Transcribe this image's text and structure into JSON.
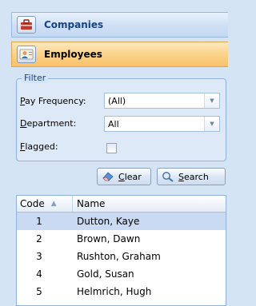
{
  "nav": {
    "companies": {
      "label": "Companies"
    },
    "employees": {
      "label": "Employees"
    }
  },
  "filter": {
    "legend": "Filter",
    "pay_frequency": {
      "label": "Pay Frequency:",
      "value": "(All)"
    },
    "department": {
      "label": "Department:",
      "value": "All"
    },
    "flagged": {
      "label": "Flagged:",
      "checked": false
    }
  },
  "buttons": {
    "clear": "Clear",
    "search": "Search"
  },
  "grid": {
    "columns": {
      "code": "Code",
      "name": "Name"
    },
    "rows": [
      {
        "code": "1",
        "name": "Dutton, Kaye"
      },
      {
        "code": "2",
        "name": "Brown, Dawn"
      },
      {
        "code": "3",
        "name": "Rushton, Graham"
      },
      {
        "code": "4",
        "name": "Gold, Susan"
      },
      {
        "code": "5",
        "name": "Helmrich, Hugh"
      }
    ]
  },
  "icons": {
    "companies": "briefcase-icon",
    "employees": "person-card-icon",
    "clear": "eraser-icon",
    "search": "magnifier-icon",
    "sort": "sort-ascending-icon"
  },
  "colors": {
    "selected_nav": "#f8c16a",
    "selected_row": "#c9daf2",
    "nav_text": "#15428b"
  }
}
